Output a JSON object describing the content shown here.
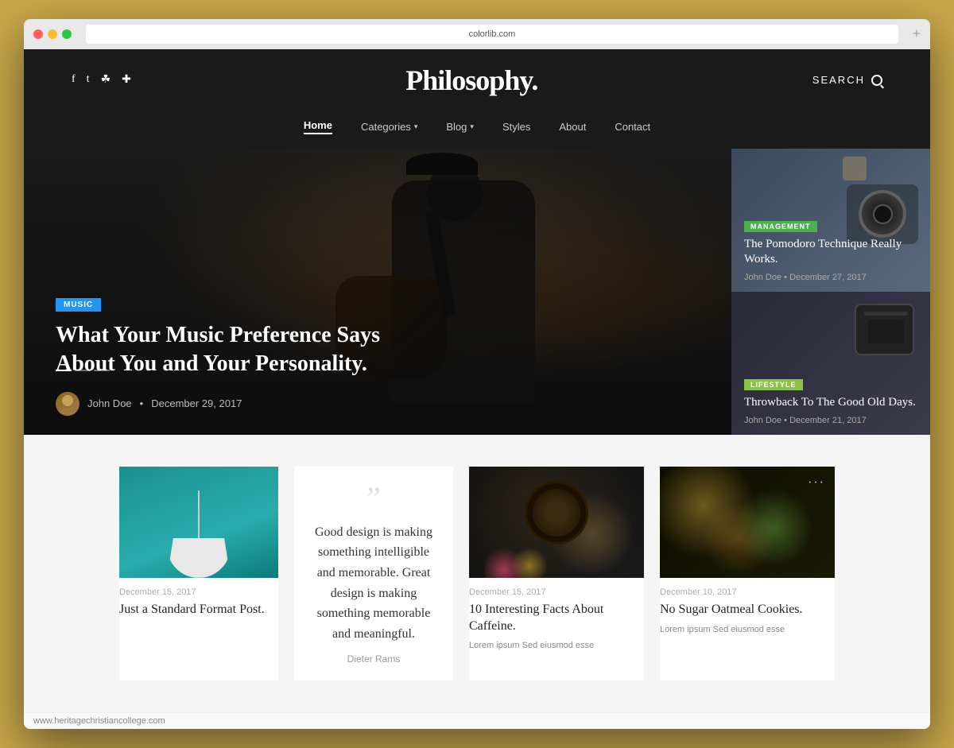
{
  "browser": {
    "url": "colorlib.com",
    "plus_label": "+"
  },
  "header": {
    "site_title": "Philosophy.",
    "search_label": "SEARCH",
    "social": [
      "f",
      "t",
      "ꜱ",
      "p"
    ]
  },
  "nav": {
    "items": [
      {
        "label": "Home",
        "active": true,
        "has_chevron": false
      },
      {
        "label": "Categories",
        "active": false,
        "has_chevron": true
      },
      {
        "label": "Blog",
        "active": false,
        "has_chevron": true
      },
      {
        "label": "Styles",
        "active": false,
        "has_chevron": false
      },
      {
        "label": "About",
        "active": false,
        "has_chevron": false
      },
      {
        "label": "Contact",
        "active": false,
        "has_chevron": false
      }
    ]
  },
  "hero": {
    "badge": "MUSIC",
    "title": "What Your Music Preference Says About You and Your Personality.",
    "author": "John Doe",
    "date": "December 29, 2017",
    "nav_dots": [
      "active",
      "",
      ""
    ]
  },
  "sidebar_cards": [
    {
      "badge": "MANAGEMENT",
      "badge_color": "#4CAF50",
      "title": "The Pomodoro Technique Really Works.",
      "author": "John Doe",
      "date": "December 27, 2017"
    },
    {
      "badge": "LIFESTYLE",
      "badge_color": "#8BC34A",
      "title": "Throwback To The Good Old Days.",
      "author": "John Doe",
      "date": "December 21, 2017"
    }
  ],
  "posts": [
    {
      "type": "image-lamp",
      "date": "December 15, 2017",
      "title": "Just a Standard Format Post.",
      "excerpt": ""
    },
    {
      "type": "quote",
      "quote_text": "Good design is making something intelligible and memorable. Great design is making something memorable and meaningful.",
      "quote_author": "Dieter Rams"
    },
    {
      "type": "image-coffee",
      "date": "December 15, 2017",
      "title": "10 Interesting Facts About Caffeine.",
      "excerpt": "Lorem ipsum Sed eiusmod esse"
    },
    {
      "type": "image-food",
      "date": "December 10, 2017",
      "title": "No Sugar Oatmeal Cookies.",
      "excerpt": "Lorem ipsum Sed eiusmod esse"
    }
  ],
  "status_bar": {
    "url": "www.heritagechristiancollege.com"
  }
}
